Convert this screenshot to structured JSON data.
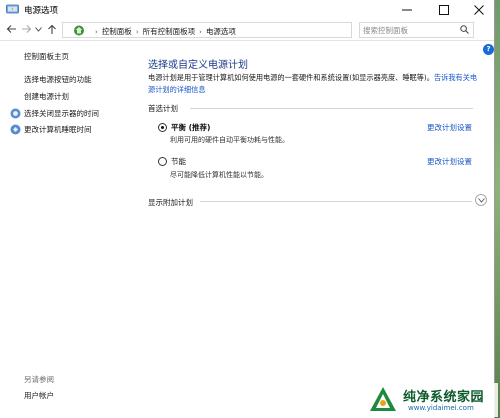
{
  "window": {
    "title": "电源选项"
  },
  "address": {
    "breadcrumbs": [
      "控制面板",
      "所有控制面板项",
      "电源选项"
    ]
  },
  "search": {
    "placeholder": "搜索控制面板"
  },
  "help": {
    "label": "?"
  },
  "sidebar": {
    "home": "控制面板主页",
    "items": [
      {
        "label": "选择电源按钮的功能"
      },
      {
        "label": "创建电源计划"
      },
      {
        "label": "选择关闭显示器的时间"
      },
      {
        "label": "更改计算机睡眠时间"
      }
    ],
    "see_also_label": "另请参阅",
    "see_also_items": [
      {
        "label": "用户帐户"
      }
    ]
  },
  "main": {
    "title": "选择或自定义电源计划",
    "description": "电源计划是用于管理计算机如何使用电源的一套硬件和系统设置(如显示器亮度、睡眠等)。",
    "description_link": "告诉我有关电源计划的详细信息",
    "preferred_header": "首选计划",
    "plans": [
      {
        "name": "平衡 (推荐)",
        "description": "利用可用的硬件自动平衡功耗与性能。",
        "link": "更改计划设置",
        "selected": true
      },
      {
        "name": "节能",
        "description": "尽可能降低计算机性能以节能。",
        "link": "更改计划设置",
        "selected": false
      }
    ],
    "additional_header": "显示附加计划"
  },
  "watermark": {
    "title": "纯净系统家园",
    "url": "www.yidaimei.com"
  },
  "colors": {
    "link": "#1a56c8",
    "title": "#1a3a8a",
    "help": "#1a6bd6"
  }
}
